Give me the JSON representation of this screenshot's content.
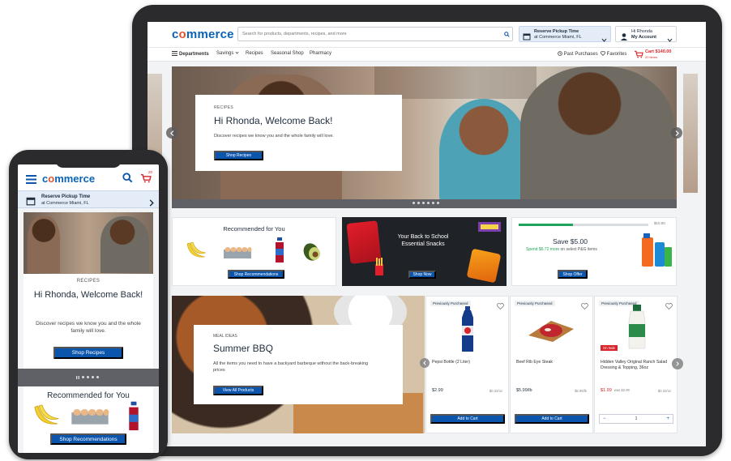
{
  "tablet": {
    "header": {
      "logo_prefix": "c",
      "logo_o": "o",
      "logo_suffix": "mmerce",
      "search_placeholder": "Search for products, departments, recipes, and more",
      "pickup_title": "Reserve Pickup Time",
      "pickup_location": "at Commerce Miami, FL",
      "account_greeting": "Hi Rhonda",
      "account_label": "My Account"
    },
    "nav": {
      "items": [
        "Departments",
        "Savings",
        "Recipes",
        "Seasonal Shop",
        "Pharmacy"
      ],
      "past_purchases": "Past Purchases",
      "favorites": "Favorites",
      "cart_total": "Cart $140.00",
      "cart_items": "20 items"
    },
    "hero": {
      "kicker": "RECIPES",
      "title": "Hi Rhonda, Welcome Back!",
      "text": "Discover recipes we know you and the whole family will love.",
      "button": "Shop Recipes"
    },
    "recommended": {
      "title": "Recommended for You",
      "button": "Shop Recommendations"
    },
    "snacks": {
      "title": "Your Back to School Essential Snacks",
      "button": "Shop Now"
    },
    "savings": {
      "goal": "$10.00",
      "progress_fraction": 0.42,
      "title": "Save $5.00",
      "spend": "Spend $6.72 more",
      "suffix": " on select P&G items",
      "button": "Shop Offer"
    },
    "bbq": {
      "kicker": "MEAL IDEAS",
      "title": "Summer BBQ",
      "text": "All the items you need to have a backyard barbeque without the back-breaking prices",
      "button": "View All Products"
    },
    "products": [
      {
        "badge": "Previously Purchased",
        "name": "Pepsi Bottle (2 Liter)",
        "price": "$2.99",
        "unit": "$0.32/oz",
        "button": "Add to Cart"
      },
      {
        "badge": "Previously Purchased",
        "name": "Beef Rib Eye Steak",
        "price": "$5.99/lb",
        "unit": "$5.99/lb",
        "button": "Add to Cart"
      },
      {
        "badge": "Previously Purchased",
        "sale": "On Sale",
        "name": "Hidden Valley Original Ranch Salad Dressing & Topping, 36oz",
        "price": "$1.99",
        "was": "was $2.99",
        "unit": "$0.32/oz",
        "qty": "1",
        "minus": "−",
        "plus": "+"
      }
    ]
  },
  "phone": {
    "logo_prefix": "c",
    "logo_o": "o",
    "logo_suffix": "mmerce",
    "cart_count": "20",
    "pickup_title": "Reserve Pickup Time",
    "pickup_location": "at Commerce Miami, FL",
    "hero": {
      "kicker": "RECIPES",
      "title": "Hi Rhonda, Welcome Back!",
      "text": "Discover recipes we know you and the whole family will love.",
      "button": "Shop Recipes"
    },
    "recommended": {
      "title": "Recommended for You",
      "button": "Shop Recommendations"
    }
  }
}
